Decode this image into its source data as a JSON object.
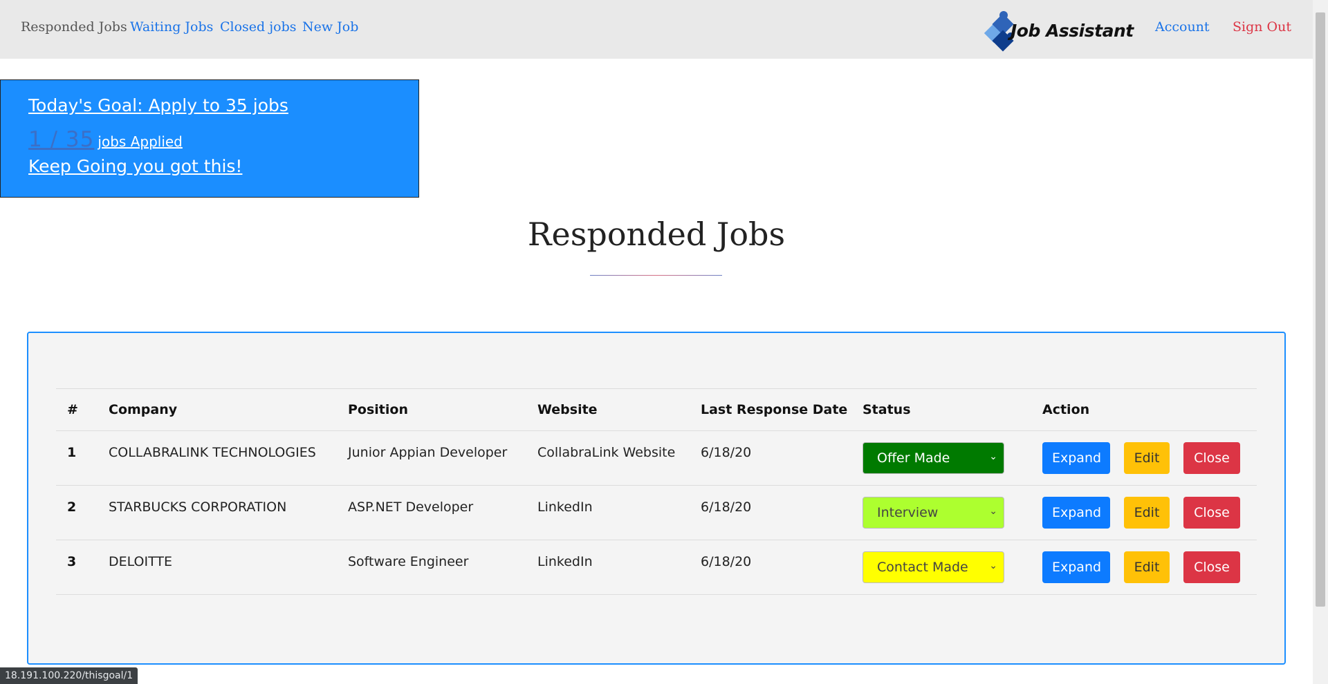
{
  "nav": {
    "links": [
      {
        "label": "Responded Jobs"
      },
      {
        "label": "Waiting Jobs"
      },
      {
        "label": "Closed jobs"
      },
      {
        "label": "New Job"
      }
    ],
    "brand": "Job Assistant",
    "account": "Account",
    "signout": "Sign Out"
  },
  "goal": {
    "title": "Today's Goal: Apply to 35 jobs",
    "count": "1 / 35",
    "applied": "jobs Applied",
    "message": "Keep Going you got this!"
  },
  "page": {
    "title": "Responded Jobs"
  },
  "table": {
    "headers": [
      "#",
      "Company",
      "Position",
      "Website",
      "Last Response Date",
      "Status",
      "Action"
    ],
    "rows": [
      {
        "num": "1",
        "company": "COLLABRALINK TECHNOLOGIES",
        "position": "Junior Appian Developer",
        "website": "CollabraLink Website",
        "date": "6/18/20",
        "status": "Offer Made",
        "status_color": "#007a00",
        "status_text_color": "#ffffff"
      },
      {
        "num": "2",
        "company": "STARBUCKS CORPORATION",
        "position": "ASP.NET Developer",
        "website": "LinkedIn",
        "date": "6/18/20",
        "status": "Interview",
        "status_color": "#adff2f",
        "status_text_color": "#444444"
      },
      {
        "num": "3",
        "company": "DELOITTE",
        "position": "Software Engineer",
        "website": "LinkedIn",
        "date": "6/18/20",
        "status": "Contact Made",
        "status_color": "#ffff00",
        "status_text_color": "#444444"
      }
    ],
    "actions": {
      "expand": "Expand",
      "edit": "Edit",
      "close": "Close"
    }
  },
  "statusbar": {
    "url": "18.191.100.220/thisgoal/1"
  },
  "colors": {
    "accent": "#1b8eff",
    "navbar": "#e9e9e9",
    "link": "#1a73e8",
    "danger": "#dc3545",
    "warning": "#ffc107",
    "primary": "#0d7bff"
  }
}
